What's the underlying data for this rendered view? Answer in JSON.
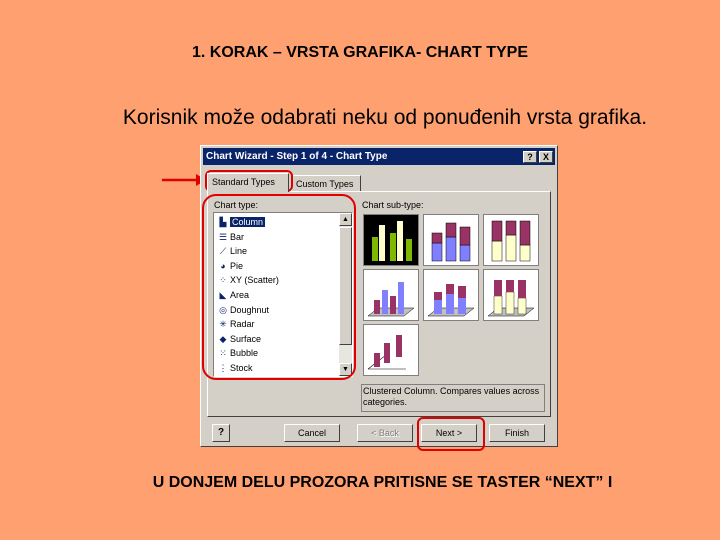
{
  "slide": {
    "title": "1. KORAK – VRSTA GRAFIKA- CHART TYPE",
    "subtitle": "Korisnik može odabrati neku od ponuđenih vrsta grafika.",
    "footer": "U DONJEM DELU PROZORA PRITISNE SE TASTER “NEXT” I"
  },
  "dialog": {
    "title": "Chart Wizard - Step 1 of 4 - Chart Type",
    "help_label": "?",
    "close_label": "X",
    "tabs": [
      {
        "label": "Standard Types",
        "active": true
      },
      {
        "label": "Custom Types",
        "active": false
      }
    ],
    "chart_type_label": "Chart type:",
    "chart_subtype_label": "Chart sub-type:",
    "chart_types": [
      {
        "label": "Column",
        "icon": "column-chart-icon",
        "glyph": "▙"
      },
      {
        "label": "Bar",
        "icon": "bar-chart-icon",
        "glyph": "☰"
      },
      {
        "label": "Line",
        "icon": "line-chart-icon",
        "glyph": "⟋"
      },
      {
        "label": "Pie",
        "icon": "pie-chart-icon",
        "glyph": "◕"
      },
      {
        "label": "XY (Scatter)",
        "icon": "scatter-chart-icon",
        "glyph": "⁘"
      },
      {
        "label": "Area",
        "icon": "area-chart-icon",
        "glyph": "◣"
      },
      {
        "label": "Doughnut",
        "icon": "doughnut-chart-icon",
        "glyph": "◎"
      },
      {
        "label": "Radar",
        "icon": "radar-chart-icon",
        "glyph": "✳"
      },
      {
        "label": "Surface",
        "icon": "surface-chart-icon",
        "glyph": "◆"
      },
      {
        "label": "Bubble",
        "icon": "bubble-chart-icon",
        "glyph": "⁙"
      },
      {
        "label": "Stock",
        "icon": "stock-chart-icon",
        "glyph": "⋮"
      }
    ],
    "selected_chart_type": "Column",
    "description": "Clustered Column. Compares values across categories.",
    "buttons": {
      "office_assistant": "?",
      "cancel": "Cancel",
      "back": "< Back",
      "next": "Next >",
      "finish": "Finish"
    },
    "colors": {
      "titlebar": "#0A246A",
      "bar_green": "#7FB800",
      "bar_blue": "#8080FF",
      "bar_maroon": "#993366",
      "bar_cream": "#FFFFCC",
      "highlight_red": "#E00000"
    }
  }
}
